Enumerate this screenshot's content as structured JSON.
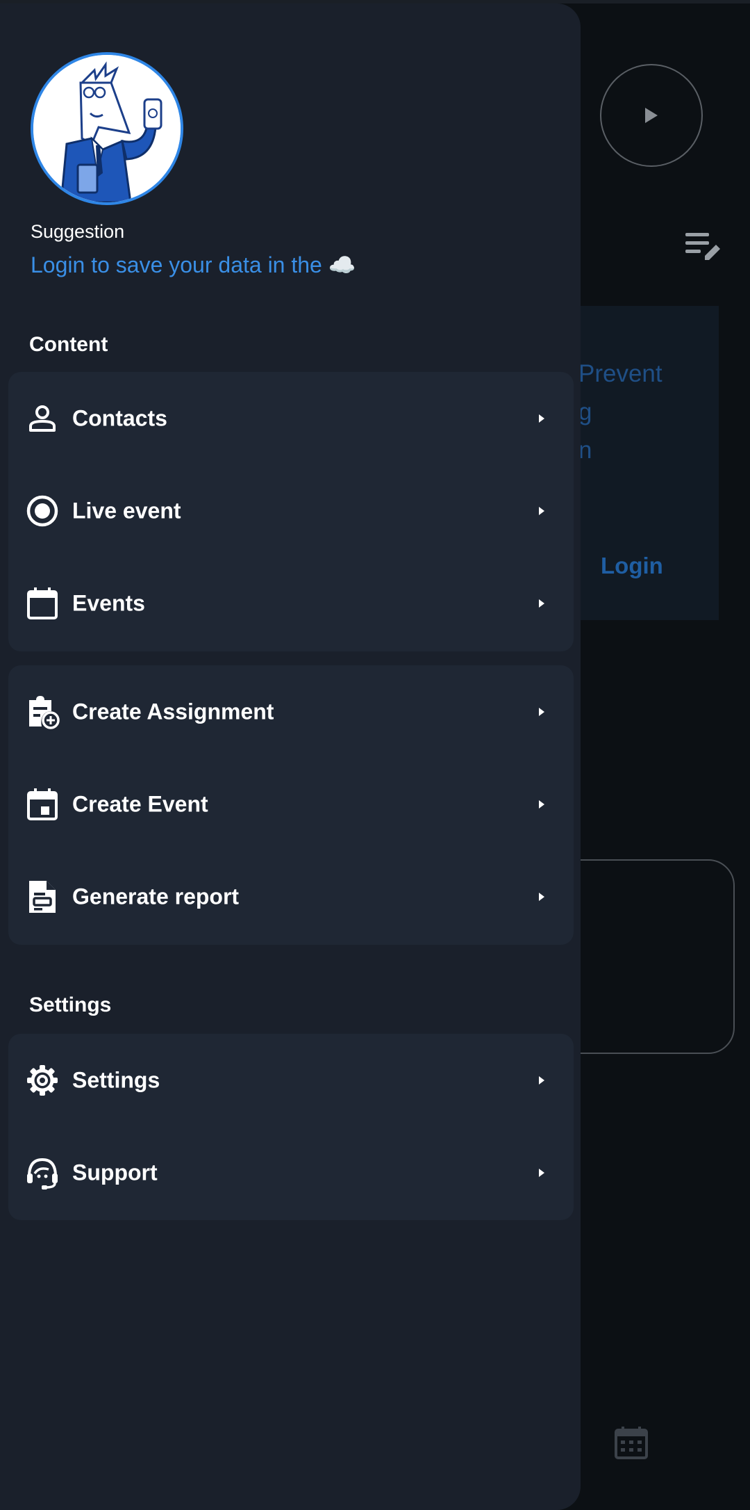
{
  "background": {
    "card_text": "Prevent\ng\nn",
    "card_login": "Login"
  },
  "drawer": {
    "suggestion_label": "Suggestion",
    "suggestion_link": "Login to save your data in the ☁️",
    "content_title": "Content",
    "settings_title": "Settings",
    "group1": [
      {
        "label": "Contacts",
        "icon": "person-icon"
      },
      {
        "label": "Live event",
        "icon": "radio-button-icon"
      },
      {
        "label": "Events",
        "icon": "calendar-icon"
      }
    ],
    "group2": [
      {
        "label": "Create Assignment",
        "icon": "clipboard-add-icon"
      },
      {
        "label": "Create Event",
        "icon": "calendar-event-icon"
      },
      {
        "label": "Generate report",
        "icon": "report-icon"
      }
    ],
    "group3": [
      {
        "label": "Settings",
        "icon": "gear-icon"
      },
      {
        "label": "Support",
        "icon": "support-agent-icon"
      }
    ]
  },
  "colors": {
    "accent": "#2f86e6",
    "drawer_bg": "#1a202b",
    "group_bg": "#1f2734"
  }
}
